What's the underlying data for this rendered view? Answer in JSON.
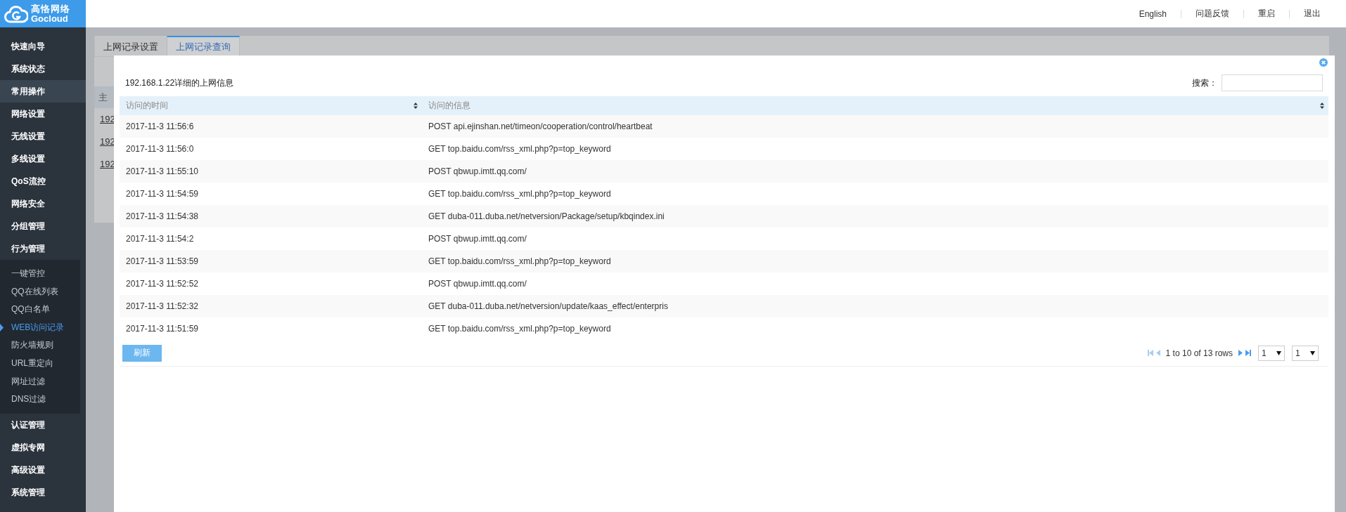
{
  "header": {
    "logo": {
      "name": "高恪网络",
      "en": "Gocloud"
    },
    "links": [
      "English",
      "问题反馈",
      "重启",
      "退出"
    ]
  },
  "sidebar": {
    "items": [
      {
        "label": "快速向导",
        "highlighted": false
      },
      {
        "label": "系统状态",
        "highlighted": false
      },
      {
        "label": "常用操作",
        "highlighted": true
      },
      {
        "label": "网络设置",
        "highlighted": false
      },
      {
        "label": "无线设置",
        "highlighted": false
      },
      {
        "label": "多线设置",
        "highlighted": false
      },
      {
        "label": "QoS流控",
        "highlighted": false
      },
      {
        "label": "网络安全",
        "highlighted": false
      },
      {
        "label": "分组管理",
        "highlighted": false
      },
      {
        "label": "行为管理",
        "highlighted": false,
        "children": [
          {
            "label": "一键管控",
            "selected": false
          },
          {
            "label": "QQ在线列表",
            "selected": false
          },
          {
            "label": "QQ白名单",
            "selected": false
          },
          {
            "label": "WEB访问记录",
            "selected": true
          },
          {
            "label": "防火墙规则",
            "selected": false
          },
          {
            "label": "URL重定向",
            "selected": false
          },
          {
            "label": "网址过滤",
            "selected": false
          },
          {
            "label": "DNS过滤",
            "selected": false
          }
        ]
      },
      {
        "label": "认证管理",
        "highlighted": false
      },
      {
        "label": "虚拟专网",
        "highlighted": false
      },
      {
        "label": "高级设置",
        "highlighted": false
      },
      {
        "label": "系统管理",
        "highlighted": false
      }
    ]
  },
  "background": {
    "tabs": [
      {
        "label": "上网记录设置",
        "selected": false
      },
      {
        "label": "上网记录查询",
        "selected": true
      }
    ],
    "table_header": "主",
    "links": [
      "192",
      "192",
      "192"
    ]
  },
  "modal": {
    "title": "192.168.1.22详细的上网信息",
    "search": {
      "label": "搜索："
    },
    "columns": [
      "访问的时间",
      "访问的信息"
    ],
    "rows": [
      {
        "time": "2017-11-3 11:56:6",
        "info": "POST api.ejinshan.net/timeon/cooperation/control/heartbeat"
      },
      {
        "time": "2017-11-3 11:56:0",
        "info": "GET top.baidu.com/rss_xml.php?p=top_keyword"
      },
      {
        "time": "2017-11-3 11:55:10",
        "info": "POST qbwup.imtt.qq.com/"
      },
      {
        "time": "2017-11-3 11:54:59",
        "info": "GET top.baidu.com/rss_xml.php?p=top_keyword"
      },
      {
        "time": "2017-11-3 11:54:38",
        "info": "GET duba-011.duba.net/netversion/Package/setup/kbqindex.ini"
      },
      {
        "time": "2017-11-3 11:54:2",
        "info": "POST qbwup.imtt.qq.com/"
      },
      {
        "time": "2017-11-3 11:53:59",
        "info": "GET top.baidu.com/rss_xml.php?p=top_keyword"
      },
      {
        "time": "2017-11-3 11:52:52",
        "info": "POST qbwup.imtt.qq.com/"
      },
      {
        "time": "2017-11-3 11:52:32",
        "info": "GET duba-011.duba.net/netversion/update/kaas_effect/enterpris"
      },
      {
        "time": "2017-11-3 11:51:59",
        "info": "GET top.baidu.com/rss_xml.php?p=top_keyword"
      }
    ],
    "refresh_button": "刷新",
    "pagination": {
      "summary": "1 to 10 of 13 rows",
      "page_size": "1",
      "page": "1"
    }
  }
}
